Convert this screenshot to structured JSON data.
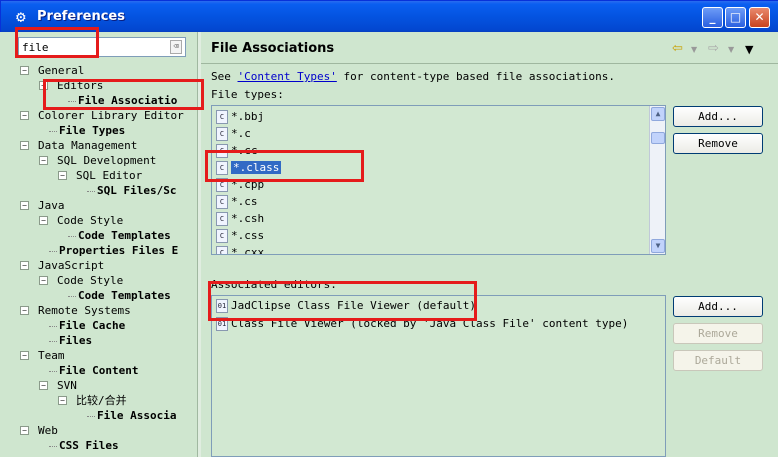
{
  "window": {
    "title": "Preferences"
  },
  "filter": {
    "value": "file"
  },
  "tree": [
    {
      "label": "General",
      "bold": false
    },
    {
      "label": "Editors",
      "bold": false
    },
    {
      "label": "File Associatio",
      "bold": true
    },
    {
      "label": "Colorer Library Editor",
      "bold": false
    },
    {
      "label": "File Types",
      "bold": true
    },
    {
      "label": "Data Management",
      "bold": false
    },
    {
      "label": "SQL Development",
      "bold": false
    },
    {
      "label": "SQL Editor",
      "bold": false
    },
    {
      "label": "SQL Files/Sc",
      "bold": true
    },
    {
      "label": "Java",
      "bold": false
    },
    {
      "label": "Code Style",
      "bold": false
    },
    {
      "label": "Code Templates",
      "bold": true
    },
    {
      "label": "Properties Files E",
      "bold": true
    },
    {
      "label": "JavaScript",
      "bold": false
    },
    {
      "label": "Code Style",
      "bold": false
    },
    {
      "label": "Code Templates",
      "bold": true
    },
    {
      "label": "Remote Systems",
      "bold": false
    },
    {
      "label": "File Cache",
      "bold": true
    },
    {
      "label": "Files",
      "bold": true
    },
    {
      "label": "Team",
      "bold": false
    },
    {
      "label": "File Content",
      "bold": true
    },
    {
      "label": "SVN",
      "bold": false
    },
    {
      "label": "比较/合并",
      "bold": false
    },
    {
      "label": "File Associa",
      "bold": true
    },
    {
      "label": "Web",
      "bold": false
    },
    {
      "label": "CSS Files",
      "bold": true
    }
  ],
  "page": {
    "title": "File Associations",
    "see_prefix": "See ",
    "see_link": "'Content Types'",
    "see_suffix": " for content-type based file associations.",
    "file_types_label": "File types:",
    "assoc_label": "Associated editors:"
  },
  "file_types": [
    "*.bbj",
    "*.c",
    "*.cc",
    "*.class",
    "*.cpp",
    "*.cs",
    "*.csh",
    "*.css",
    "*.cxx"
  ],
  "selected_file_type": "*.class",
  "editors": [
    "JadClipse Class File Viewer (default)",
    "Class File Viewer (locked by 'Java Class File' content type)"
  ],
  "buttons": {
    "add_type": "Add...",
    "remove_type": "Remove",
    "add_editor": "Add...",
    "remove_editor": "Remove",
    "default_editor": "Default"
  },
  "nav": {
    "back": "⇦",
    "forward": "⇨",
    "menu": "▼"
  },
  "icons": {
    "title": "gear-icon",
    "file": "class-file-icon"
  },
  "colors": {
    "highlight": "#e51b1b",
    "selection": "#316ac5",
    "panel": "#cfe6cf"
  }
}
